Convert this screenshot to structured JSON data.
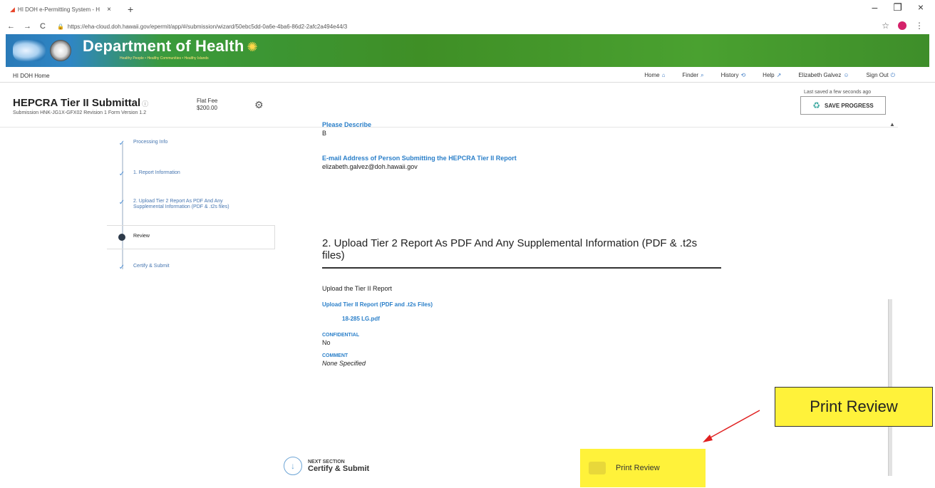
{
  "browser": {
    "tab_title": "HI DOH e-Permitting System - H",
    "url": "https://eha-cloud.doh.hawaii.gov/epermit/app/#/submission/wizard/50ebc5dd-0a6e-4ba6-86d2-2afc2a494e44/3",
    "new_tab": "+",
    "close_tab": "×",
    "win_min": "–",
    "win_max": "❐",
    "win_close": "×",
    "back": "←",
    "forward": "→",
    "reload": "C",
    "star": "☆",
    "menu": "⋮"
  },
  "banner": {
    "title": "Department of Health",
    "tagline": "Healthy People • Healthy Communities • Healthy Islands"
  },
  "subnav": {
    "home": "HI DOH Home",
    "links": [
      {
        "label": "Home",
        "icon": "⌂"
      },
      {
        "label": "Finder",
        "icon": "⌕"
      },
      {
        "label": "History",
        "icon": "⟲"
      },
      {
        "label": "Help",
        "icon": "↗"
      },
      {
        "label": "Elizabeth Galvez",
        "icon": "☺"
      },
      {
        "label": "Sign Out",
        "icon": "⏻"
      }
    ]
  },
  "submission": {
    "title": "HEPCRA Tier II Submittal",
    "meta": "Submission HNK-JG1X-GFX02    Revision 1    Form Version 1.2",
    "fee_label": "Flat Fee",
    "fee_value": "$200.00",
    "last_saved": "Last saved a few seconds ago",
    "save_label": "SAVE PROGRESS"
  },
  "steps": [
    {
      "label": "Processing Info"
    },
    {
      "label": "1. Report Information"
    },
    {
      "label": "2. Upload Tier 2 Report As PDF And Any Supplemental Information (PDF & .t2s files)"
    },
    {
      "label": "Review"
    },
    {
      "label": "Certify & Submit"
    }
  ],
  "main": {
    "please_describe_label": "Please Describe",
    "please_describe_value": "B",
    "email_label": "E-mail Address of Person Submitting the HEPCRA Tier II Report",
    "email_value": "elizabeth.galvez@doh.hawaii.gov",
    "section_title": "2. Upload Tier 2 Report As PDF And Any Supplemental Information (PDF & .t2s files)",
    "upload_heading": "Upload the Tier II Report",
    "upload_label": "Upload Tier II Report (PDF and .t2s Files)",
    "file_name": "18-285 LG.pdf",
    "confidential_label": "CONFIDENTIAL",
    "confidential_value": "No",
    "comment_label": "COMMENT",
    "comment_value": "None Specified"
  },
  "footer": {
    "next_label": "NEXT SECTION",
    "next_value": "Certify & Submit",
    "print_label": "Print Review"
  },
  "callout": {
    "text": "Print Review"
  }
}
